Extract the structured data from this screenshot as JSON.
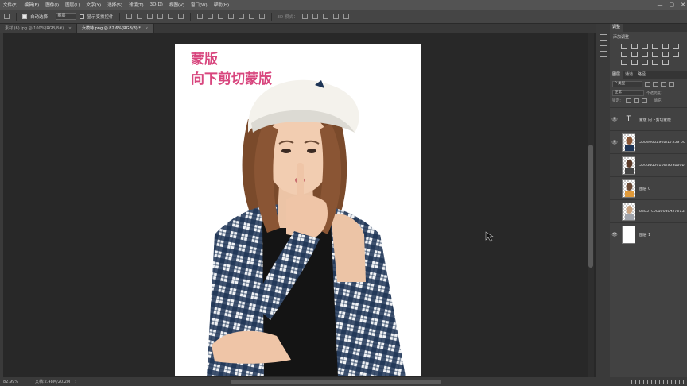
{
  "menu": [
    "文件(F)",
    "编辑(E)",
    "图像(I)",
    "图层(L)",
    "文字(Y)",
    "选择(S)",
    "滤镜(T)",
    "3D(D)",
    "视图(V)",
    "窗口(W)",
    "帮助(H)"
  ],
  "window_controls": {
    "minimize": "—",
    "restore": "▢",
    "close": "✕"
  },
  "options": {
    "auto_select_label": "自动选择：",
    "auto_select_value": "图层",
    "show_transform_label": "显示变换控件",
    "mode_3d_label": "3D 模式："
  },
  "tabs": [
    {
      "title": "素材 (6).jpg @ 100%(RGB/8#)",
      "active": false
    },
    {
      "title": "女模特.png @ 82.6%(RGB/8) *",
      "active": true
    }
  ],
  "tab_close": "×",
  "canvas": {
    "overlay_line1": "蒙版",
    "overlay_line2": "向下剪切蒙版",
    "overlay_color": "#d8467e"
  },
  "status": {
    "zoom": "82.99%",
    "doc": "文档:2.48M/20.2M",
    "arrow": "›"
  },
  "adjust_panel": {
    "tab": "调整",
    "add_label": "添加调整"
  },
  "layers_panel": {
    "tabs": [
      "图层",
      "通道",
      "路径"
    ],
    "filter_kind": "P 类型",
    "blend_mode": "正常",
    "opacity_label": "不透明度：",
    "lock_label": "锁定：",
    "fill_label": "填充：",
    "eye_glyph": "👁",
    "clip_glyph": "↓",
    "text_glyph": "T",
    "layers": [
      {
        "name": "蒙版 向下剪切蒙版",
        "kind": "text",
        "visible": true,
        "clipped": false
      },
      {
        "name": "30be0602908f17559 0cc...",
        "kind": "photo",
        "visible": true,
        "clipped": true
      },
      {
        "name": "35dddd561b6f959b80b...",
        "kind": "photo",
        "visible": false,
        "clipped": false
      },
      {
        "name": "图层 0",
        "kind": "photo-orange",
        "visible": false,
        "clipped": false
      },
      {
        "name": "8e837c0cd00ac457e13a...",
        "kind": "photo",
        "visible": false,
        "clipped": false
      },
      {
        "name": "图层 1",
        "kind": "white",
        "visible": true,
        "clipped": false
      }
    ]
  },
  "colors": {
    "accent_pink": "#d8467e",
    "shirt_navy": "#1e3556",
    "bg_dark": "#282828"
  }
}
